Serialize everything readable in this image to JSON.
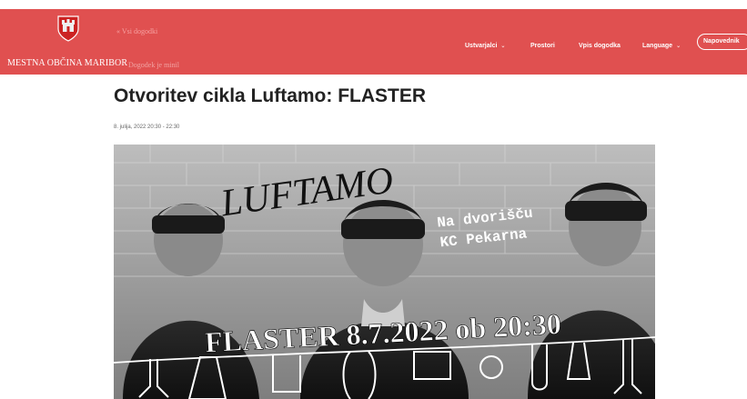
{
  "header": {
    "logo_text": "MESTNA OBČINA MARIBOR",
    "back_link": "« Vsi dogodki",
    "sub_link": "Dogodek je minil",
    "nav": [
      {
        "label": "Ustvarjalci",
        "has_dropdown": true
      },
      {
        "label": "Prostori",
        "has_dropdown": false
      },
      {
        "label": "Vpis dogodka",
        "has_dropdown": false
      },
      {
        "label": "Language",
        "has_dropdown": true
      }
    ],
    "cta_label": "Napovednik",
    "colors": {
      "header_bg": "#e05050",
      "text": "#ffffff"
    }
  },
  "event": {
    "title": "Otvoritev cikla Luftamo: FLASTER",
    "datetime": "8. julija, 2022 20:30 - 22:30"
  },
  "poster": {
    "brand": "LUFTAMO",
    "venue_line1": "Na dvorišču",
    "venue_line2": "KC Pekarna",
    "headline": "FLASTER 8.7.2022 ob 20:30"
  }
}
